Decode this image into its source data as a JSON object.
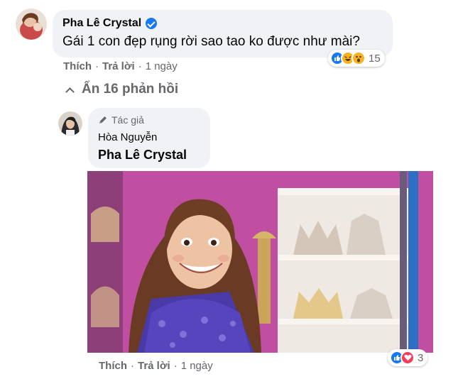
{
  "comment": {
    "author": "Pha Lê Crystal",
    "text": "Gái 1 con đẹp rụng rời sao tao ko được như mài?",
    "reactions": {
      "icons": [
        "like-icon",
        "haha-icon",
        "wow-icon"
      ],
      "count": "15"
    },
    "actions": {
      "like": "Thích",
      "reply": "Trả lời",
      "time": "1 ngày",
      "separator": "·"
    }
  },
  "replies_toggle": {
    "label": "Ẩn 16 phản hồi",
    "icon": "chevron-up-icon"
  },
  "reply": {
    "badge": "Tác giả",
    "author": "Hòa Nguyễn",
    "mention": "Pha Lê Crystal",
    "media": {
      "type": "gif"
    },
    "reactions": {
      "icons": [
        "like-icon",
        "love-icon"
      ],
      "count": "3"
    },
    "actions": {
      "like": "Thích",
      "reply": "Trả lời",
      "time": "1 ngày",
      "separator": "·"
    }
  },
  "colors": {
    "bubble": "#f0f2f5",
    "meta_text": "#65676b",
    "like_blue": "#1877f2",
    "love_red": "#f33e58",
    "wow_yellow": "#f7b125"
  }
}
